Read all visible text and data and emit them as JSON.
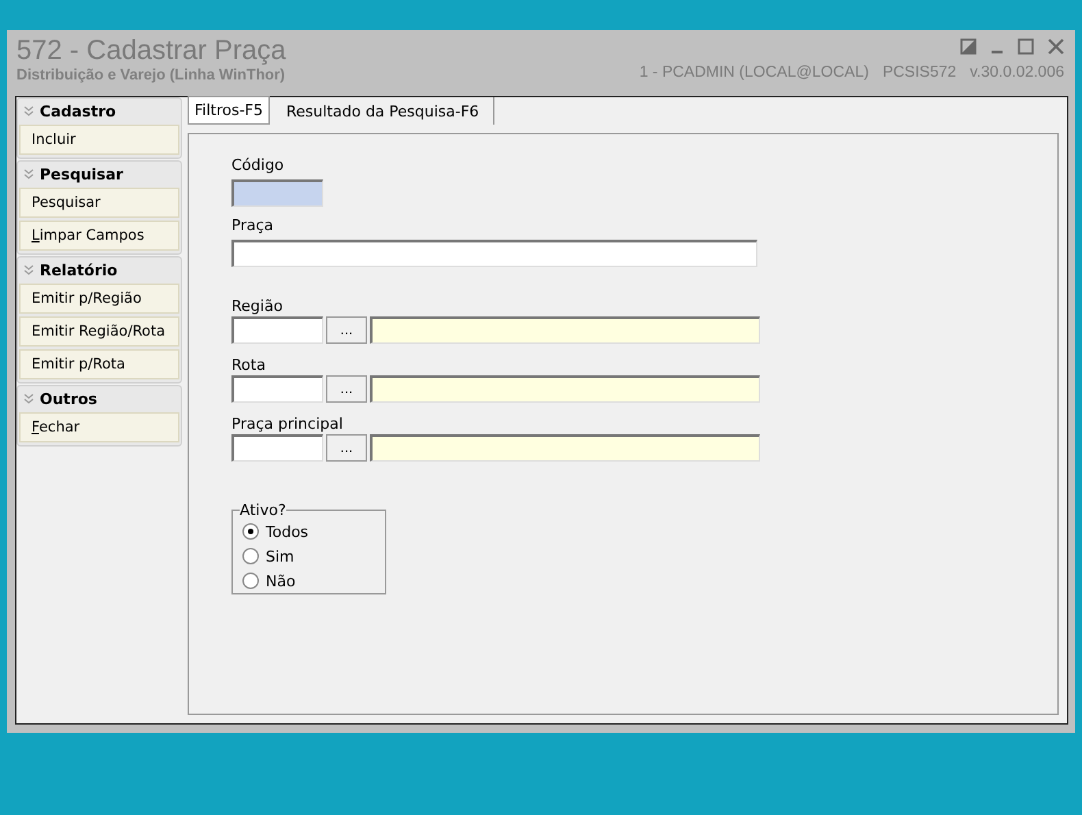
{
  "window": {
    "title": "572 - Cadastrar Praça",
    "subtitle": "Distribuição e Varejo (Linha WinThor)",
    "user_info": "1 - PCADMIN (LOCAL@LOCAL)",
    "program": "PCSIS572",
    "version": "v.30.0.02.006"
  },
  "sidebar": [
    {
      "title": "Cadastro",
      "items": [
        {
          "label": "Incluir",
          "underline_first": false
        }
      ]
    },
    {
      "title": "Pesquisar",
      "items": [
        {
          "label": "Pesquisar",
          "underline_first": false
        },
        {
          "label": "Limpar Campos",
          "underline_first": true
        }
      ]
    },
    {
      "title": "Relatório",
      "items": [
        {
          "label": "Emitir p/Região",
          "underline_first": false
        },
        {
          "label": "Emitir Região/Rota",
          "underline_first": false
        },
        {
          "label": "Emitir p/Rota",
          "underline_first": false
        }
      ]
    },
    {
      "title": "Outros",
      "items": [
        {
          "label": "Fechar",
          "underline_first": true
        }
      ]
    }
  ],
  "tabs": [
    {
      "label": "Filtros-F5",
      "selected": true
    },
    {
      "label": "Resultado da Pesquisa-F6",
      "selected": false
    }
  ],
  "form": {
    "fields": [
      {
        "kind": "code",
        "label": "Código"
      },
      {
        "kind": "text",
        "label": "Praça"
      },
      {
        "kind": "lookup",
        "label": "Região",
        "button": "..."
      },
      {
        "kind": "lookup",
        "label": "Rota",
        "button": "..."
      },
      {
        "kind": "lookup",
        "label": "Praça principal",
        "button": "..."
      }
    ],
    "active_group": {
      "title": "Ativo?",
      "options": [
        {
          "label": "Todos",
          "selected": true
        },
        {
          "label": "Sim",
          "selected": false
        },
        {
          "label": "Não",
          "selected": false
        }
      ]
    }
  }
}
